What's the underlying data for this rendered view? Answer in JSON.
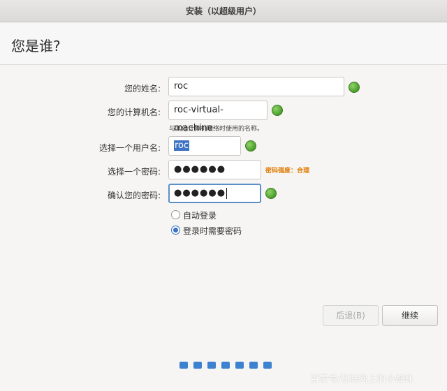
{
  "window": {
    "title": "安装（以超级用户）"
  },
  "page": {
    "title": "您是谁?"
  },
  "form": {
    "name": {
      "label": "您的姓名:",
      "value": "roc"
    },
    "computer": {
      "label": "您的计算机名:",
      "value": "roc-virtual-machine",
      "hint": "与其他计算机联络时使用的名称。"
    },
    "username": {
      "label": "选择一个用户名:",
      "value": "roc"
    },
    "password": {
      "label": "选择一个密码:",
      "value": "●●●●●●",
      "strength": "密码强度：合理"
    },
    "confirm": {
      "label": "确认您的密码:",
      "value": "●●●●●●"
    }
  },
  "login": {
    "auto_label": "自动登录",
    "require_password_label": "登录时需要密码",
    "selected": "require_password"
  },
  "buttons": {
    "back": "后退(B)",
    "continue": "继续"
  },
  "progress": {
    "total_steps": 7
  },
  "watermark": "百家号/互联网上的小蜘蛛",
  "colors": {
    "accent": "#3d73c4",
    "ok": "#4a9e2a",
    "strength": "#e07b00"
  }
}
